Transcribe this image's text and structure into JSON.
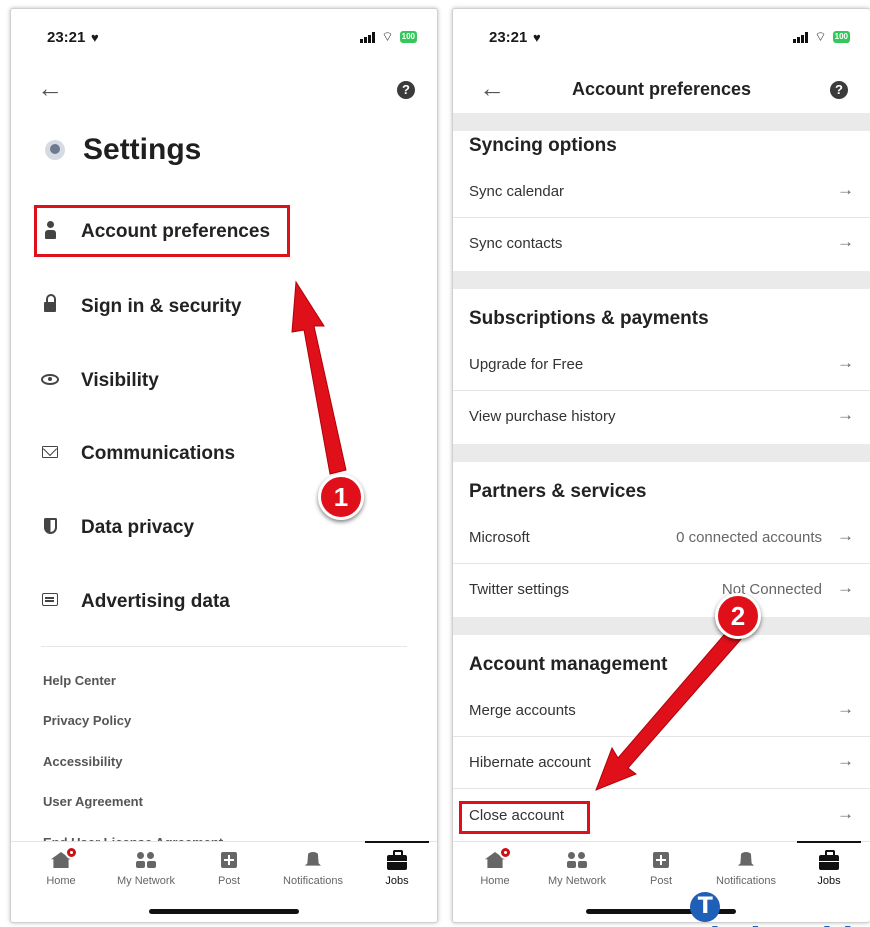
{
  "status": {
    "time": "23:21",
    "battery": "100"
  },
  "left": {
    "title": "Settings",
    "menu": [
      {
        "label": "Account preferences",
        "icon": "person-icon"
      },
      {
        "label": "Sign in & security",
        "icon": "lock-icon"
      },
      {
        "label": "Visibility",
        "icon": "eye-icon"
      },
      {
        "label": "Communications",
        "icon": "mail-icon"
      },
      {
        "label": "Data privacy",
        "icon": "shield-icon"
      },
      {
        "label": "Advertising data",
        "icon": "ad-icon"
      }
    ],
    "footer_links": [
      "Help Center",
      "Privacy Policy",
      "Accessibility",
      "User Agreement",
      "End User License Agreement"
    ],
    "help_icon": "?"
  },
  "right": {
    "title": "Account preferences",
    "sections": [
      {
        "title": "Syncing options",
        "rows": [
          {
            "label": "Sync calendar",
            "value": ""
          },
          {
            "label": "Sync contacts",
            "value": ""
          }
        ]
      },
      {
        "title": "Subscriptions & payments",
        "rows": [
          {
            "label": "Upgrade for Free",
            "value": ""
          },
          {
            "label": "View purchase history",
            "value": ""
          }
        ]
      },
      {
        "title": "Partners & services",
        "rows": [
          {
            "label": "Microsoft",
            "value": "0 connected accounts"
          },
          {
            "label": "Twitter settings",
            "value": "Not Connected"
          }
        ]
      },
      {
        "title": "Account management",
        "rows": [
          {
            "label": "Merge accounts",
            "value": ""
          },
          {
            "label": "Hibernate account",
            "value": ""
          },
          {
            "label": "Close account",
            "value": ""
          }
        ]
      }
    ]
  },
  "nav": [
    {
      "label": "Home",
      "icon": "home-icon"
    },
    {
      "label": "My Network",
      "icon": "network-icon"
    },
    {
      "label": "Post",
      "icon": "post-icon"
    },
    {
      "label": "Notifications",
      "icon": "bell-icon"
    },
    {
      "label": "Jobs",
      "icon": "briefcase-icon",
      "active": true
    }
  ],
  "annotations": {
    "step1": "1",
    "step2": "2",
    "color": "#e0101a"
  },
  "watermark": {
    "letter": "T",
    "text": "aimienphi"
  }
}
